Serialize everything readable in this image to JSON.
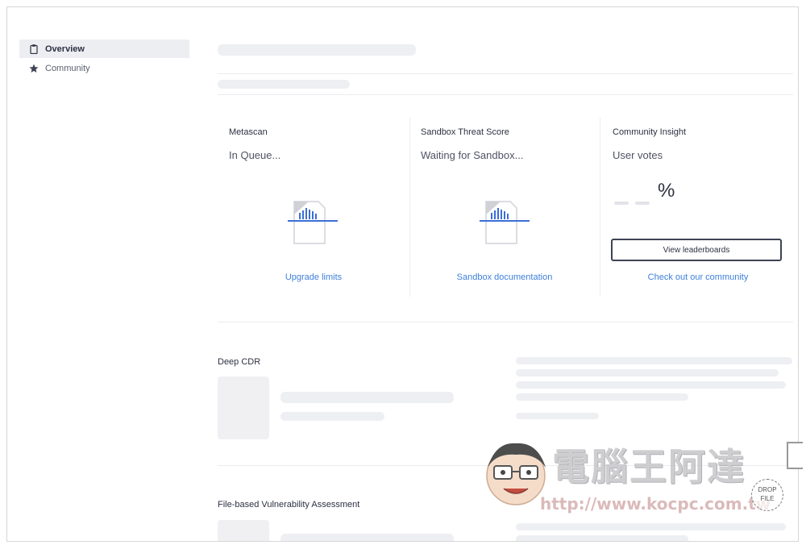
{
  "sidebar": {
    "items": [
      {
        "label": "Overview",
        "icon": "clipboard-icon",
        "active": true
      },
      {
        "label": "Community",
        "icon": "star-icon",
        "active": false
      }
    ]
  },
  "cards": [
    {
      "title": "Metascan",
      "status": "In Queue...",
      "link": "Upgrade limits"
    },
    {
      "title": "Sandbox Threat Score",
      "status": "Waiting for Sandbox...",
      "link": "Sandbox documentation"
    },
    {
      "title": "Community Insight",
      "status": "User votes",
      "percent": "%",
      "button": "View leaderboards",
      "link": "Check out our community"
    }
  ],
  "sections": {
    "deep_cdr": "Deep CDR",
    "vulnerability": "File-based Vulnerability Assessment"
  },
  "watermark": {
    "title": "電腦王阿達",
    "url": "http://www.kocpc.com.tw"
  },
  "drop_zone": {
    "line1": "DROP",
    "line2": "FILE"
  },
  "colors": {
    "link": "#3e7fdc",
    "accent_blue": "#3b6fd6",
    "skeleton": "#eeeff3",
    "text": "#2d3142"
  }
}
